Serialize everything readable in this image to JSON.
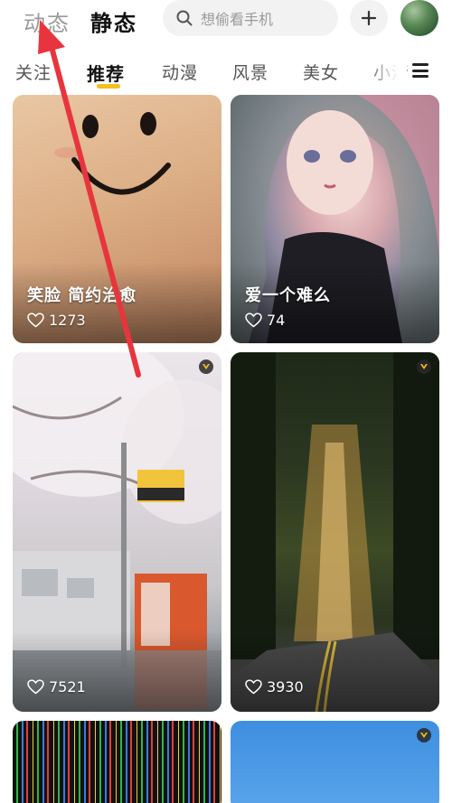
{
  "header": {
    "tab_dynamic": "动态",
    "tab_static": "静态",
    "search_placeholder": "想偷看手机"
  },
  "categories": [
    "关注",
    "推荐",
    "动漫",
    "风景",
    "美女",
    "小清"
  ],
  "active_category": "推荐",
  "cards": [
    {
      "title": "笑脸 简约治愈",
      "likes": "1273",
      "premium": false
    },
    {
      "title": "爱一个难么",
      "likes": "74",
      "premium": false
    },
    {
      "title": "",
      "likes": "7521",
      "premium": true
    },
    {
      "title": "",
      "likes": "3930",
      "premium": true
    },
    {
      "title": "",
      "likes": "",
      "premium": false
    },
    {
      "title": "",
      "likes": "",
      "premium": true
    }
  ],
  "colors": {
    "accent": "#f4c01e",
    "arrow": "#e8353d"
  },
  "icons": [
    "search-icon",
    "plus-icon",
    "menu-icon",
    "heart-icon",
    "premium-badge-icon"
  ]
}
